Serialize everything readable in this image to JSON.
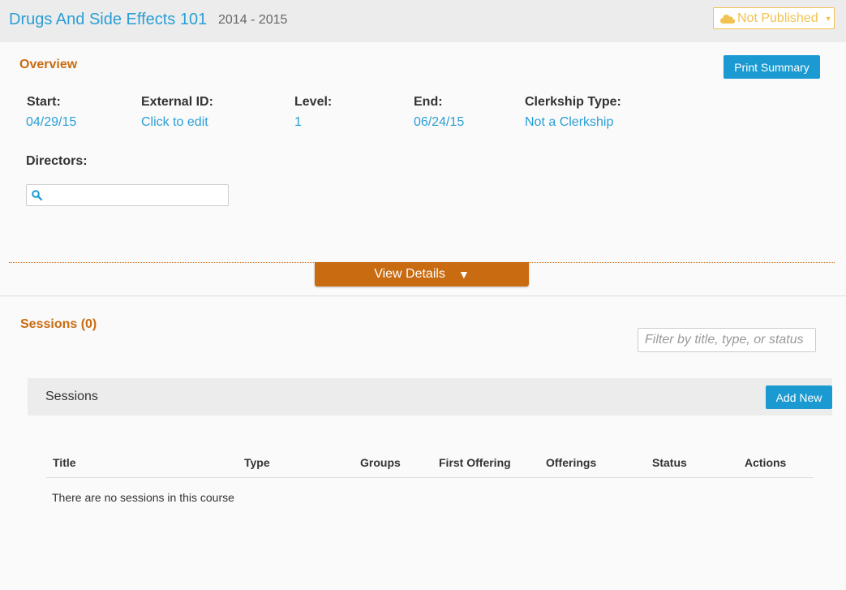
{
  "header": {
    "course_title": "Drugs And Side Effects 101",
    "course_year": "2014 - 2015",
    "publish_status": "Not Published"
  },
  "overview": {
    "title": "Overview",
    "print_button": "Print Summary",
    "fields": [
      {
        "label": "Start:",
        "value": "04/29/15"
      },
      {
        "label": "External ID:",
        "value": "Click to edit"
      },
      {
        "label": "Level:",
        "value": "1"
      },
      {
        "label": "End:",
        "value": "06/24/15"
      },
      {
        "label": "Clerkship Type:",
        "value": "Not a Clerkship"
      }
    ],
    "directors_label": "Directors:",
    "directors_value": "",
    "view_details": "View Details",
    "view_details_arrow": "▼"
  },
  "sessions": {
    "title": "Sessions (0)",
    "filter_placeholder": "Filter by title, type, or status",
    "bar_label": "Sessions",
    "add_new": "Add New",
    "columns": [
      "Title",
      "Type",
      "Groups",
      "First Offering",
      "Offerings",
      "Status",
      "Actions"
    ],
    "empty_message": "There are no sessions in this course"
  },
  "colors": {
    "accent_blue": "#1b9ad1",
    "link_blue": "#2a9fd6",
    "section_orange": "#c96b10",
    "publish_yellow": "#f2c24f"
  }
}
